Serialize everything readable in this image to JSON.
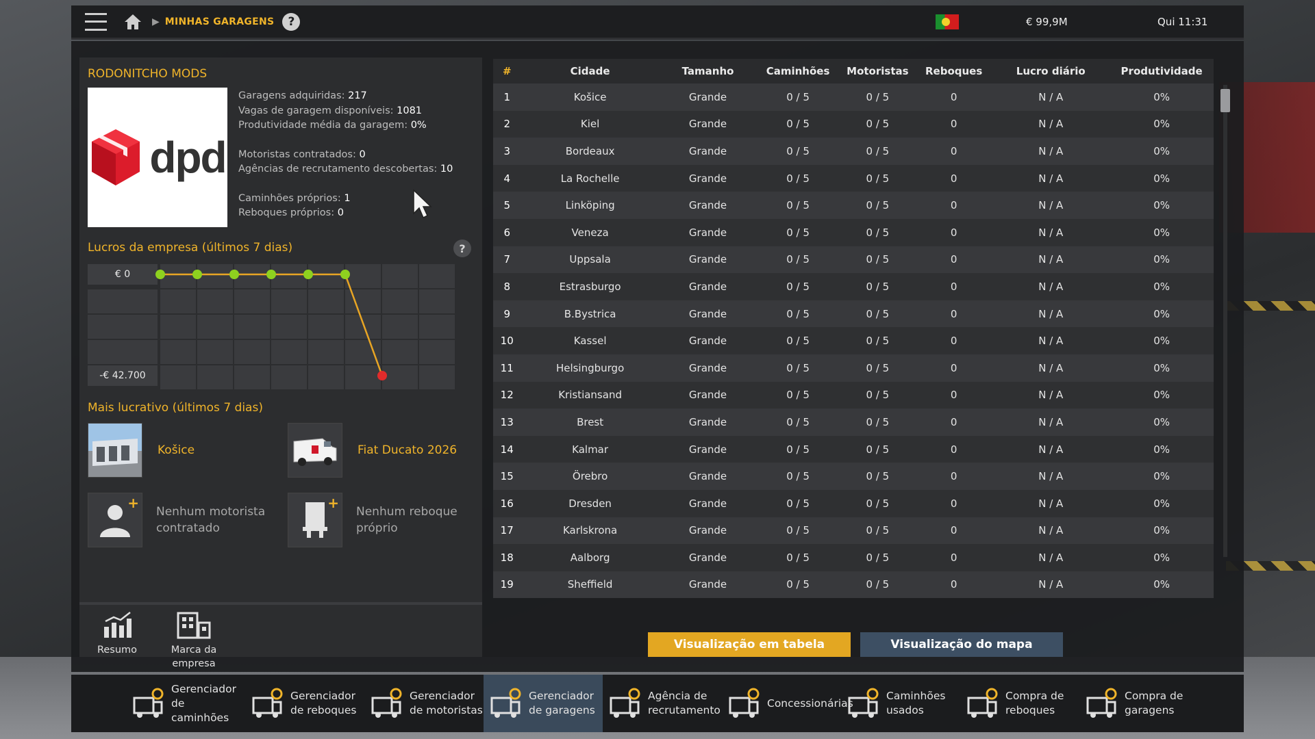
{
  "topbar": {
    "breadcrumb": "MINHAS GARAGENS",
    "help": "?",
    "money": "€ 99,9M",
    "clock": "Qui 11:31"
  },
  "company": {
    "name": "RODONITCHO MODS",
    "logo_text": "dpd",
    "stats": [
      {
        "label": "Garagens adquiridas:",
        "value": "217"
      },
      {
        "label": "Vagas de garagem disponíveis:",
        "value": "1081"
      },
      {
        "label": "Produtividade média da garagem:",
        "value": "0%"
      },
      {
        "label": "Motoristas contratados:",
        "value": "0"
      },
      {
        "label": "Agências de recrutamento descobertas:",
        "value": "10"
      },
      {
        "label": "Caminhões próprios:",
        "value": "1"
      },
      {
        "label": "Reboques próprios:",
        "value": "0"
      }
    ]
  },
  "profits": {
    "title": "Lucros da empresa (últimos 7 dias)",
    "help": "?",
    "y_top": "€ 0",
    "y_bottom": "-€ 42.700"
  },
  "chart_data": {
    "type": "line",
    "title": "Lucros da empresa (últimos 7 dias)",
    "series": [
      {
        "values": [
          0,
          0,
          0,
          0,
          0,
          0,
          -42700
        ]
      }
    ],
    "ylim": [
      -42700,
      0
    ],
    "colors": {
      "line": "#e8a524",
      "point_ok": "#8ed11f",
      "point_neg": "#e02b2b"
    }
  },
  "most_profitable": {
    "title": "Mais lucrativo (últimos 7 dias)",
    "garage": "Košice",
    "truck": "Fiat Ducato 2026",
    "driver": "Nenhum motorista contratado",
    "trailer": "Nenhum reboque próprio"
  },
  "left_tabs": [
    {
      "label": "Resumo"
    },
    {
      "label": "Marca da empresa"
    }
  ],
  "table": {
    "headers": [
      "#",
      "Cidade",
      "Tamanho",
      "Caminhões",
      "Motoristas",
      "Reboques",
      "Lucro diário",
      "Produtividade"
    ],
    "rows": [
      [
        "1",
        "Košice",
        "Grande",
        "0 / 5",
        "0 / 5",
        "0",
        "N / A",
        "0%"
      ],
      [
        "2",
        "Kiel",
        "Grande",
        "0 / 5",
        "0 / 5",
        "0",
        "N / A",
        "0%"
      ],
      [
        "3",
        "Bordeaux",
        "Grande",
        "0 / 5",
        "0 / 5",
        "0",
        "N / A",
        "0%"
      ],
      [
        "4",
        "La Rochelle",
        "Grande",
        "0 / 5",
        "0 / 5",
        "0",
        "N / A",
        "0%"
      ],
      [
        "5",
        "Linköping",
        "Grande",
        "0 / 5",
        "0 / 5",
        "0",
        "N / A",
        "0%"
      ],
      [
        "6",
        "Veneza",
        "Grande",
        "0 / 5",
        "0 / 5",
        "0",
        "N / A",
        "0%"
      ],
      [
        "7",
        "Uppsala",
        "Grande",
        "0 / 5",
        "0 / 5",
        "0",
        "N / A",
        "0%"
      ],
      [
        "8",
        "Estrasburgo",
        "Grande",
        "0 / 5",
        "0 / 5",
        "0",
        "N / A",
        "0%"
      ],
      [
        "9",
        "B.Bystrica",
        "Grande",
        "0 / 5",
        "0 / 5",
        "0",
        "N / A",
        "0%"
      ],
      [
        "10",
        "Kassel",
        "Grande",
        "0 / 5",
        "0 / 5",
        "0",
        "N / A",
        "0%"
      ],
      [
        "11",
        "Helsingburgo",
        "Grande",
        "0 / 5",
        "0 / 5",
        "0",
        "N / A",
        "0%"
      ],
      [
        "12",
        "Kristiansand",
        "Grande",
        "0 / 5",
        "0 / 5",
        "0",
        "N / A",
        "0%"
      ],
      [
        "13",
        "Brest",
        "Grande",
        "0 / 5",
        "0 / 5",
        "0",
        "N / A",
        "0%"
      ],
      [
        "14",
        "Kalmar",
        "Grande",
        "0 / 5",
        "0 / 5",
        "0",
        "N / A",
        "0%"
      ],
      [
        "15",
        "Örebro",
        "Grande",
        "0 / 5",
        "0 / 5",
        "0",
        "N / A",
        "0%"
      ],
      [
        "16",
        "Dresden",
        "Grande",
        "0 / 5",
        "0 / 5",
        "0",
        "N / A",
        "0%"
      ],
      [
        "17",
        "Karlskrona",
        "Grande",
        "0 / 5",
        "0 / 5",
        "0",
        "N / A",
        "0%"
      ],
      [
        "18",
        "Aalborg",
        "Grande",
        "0 / 5",
        "0 / 5",
        "0",
        "N / A",
        "0%"
      ],
      [
        "19",
        "Sheffield",
        "Grande",
        "0 / 5",
        "0 / 5",
        "0",
        "N / A",
        "0%"
      ]
    ]
  },
  "views": {
    "table": "Visualização em tabela",
    "map": "Visualização do mapa"
  },
  "bottom_nav": [
    {
      "label": "Gerenciador de caminhões",
      "icon": "truck-manager-icon",
      "active": false
    },
    {
      "label": "Gerenciador de reboques",
      "icon": "trailer-manager-icon",
      "active": false
    },
    {
      "label": "Gerenciador de motoristas",
      "icon": "driver-manager-icon",
      "active": false
    },
    {
      "label": "Gerenciador de garagens",
      "icon": "garage-manager-icon",
      "active": true
    },
    {
      "label": "Agência de recrutamento",
      "icon": "recruitment-agency-icon",
      "active": false
    },
    {
      "label": "Concessionárias",
      "icon": "dealership-icon",
      "active": false
    },
    {
      "label": "Caminhões usados",
      "icon": "used-trucks-icon",
      "active": false
    },
    {
      "label": "Compra de reboques",
      "icon": "buy-trailers-icon",
      "active": false
    },
    {
      "label": "Compra de garagens",
      "icon": "buy-garages-icon",
      "active": false
    }
  ]
}
